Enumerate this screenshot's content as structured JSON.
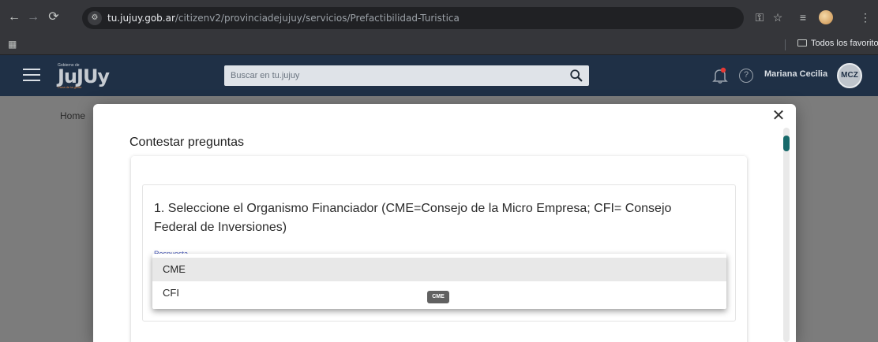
{
  "browser": {
    "url_host": "tu.jujuy.gob.ar",
    "url_path": "/citizenv2/provinciadejujuy/servicios/Prefactibilidad-Turistica",
    "bookmarks_folder": "Todos los favoritos"
  },
  "header": {
    "logo_small": "Gobierno de",
    "logo_text": "JuJUy",
    "logo_tag": "Cuna de la gente",
    "search_placeholder": "Buscar en tu.jujuy",
    "user_name": "Mariana Cecilia",
    "avatar_initials": "MCZ"
  },
  "page": {
    "breadcrumb": "Home"
  },
  "modal": {
    "title": "Contestar preguntas",
    "question": "1. Seleccione el Organismo Financiador (CME=Consejo de la Micro Empresa; CFI= Consejo Federal de Inversiones)",
    "answer_label": "Respuesta",
    "close_symbol": "✕"
  },
  "dropdown": {
    "options": [
      "CME",
      "CFI"
    ],
    "selected": "CME",
    "tooltip": "CME"
  },
  "colors": {
    "header_bg": "#1f3046",
    "scroll_thumb": "#17696a"
  }
}
